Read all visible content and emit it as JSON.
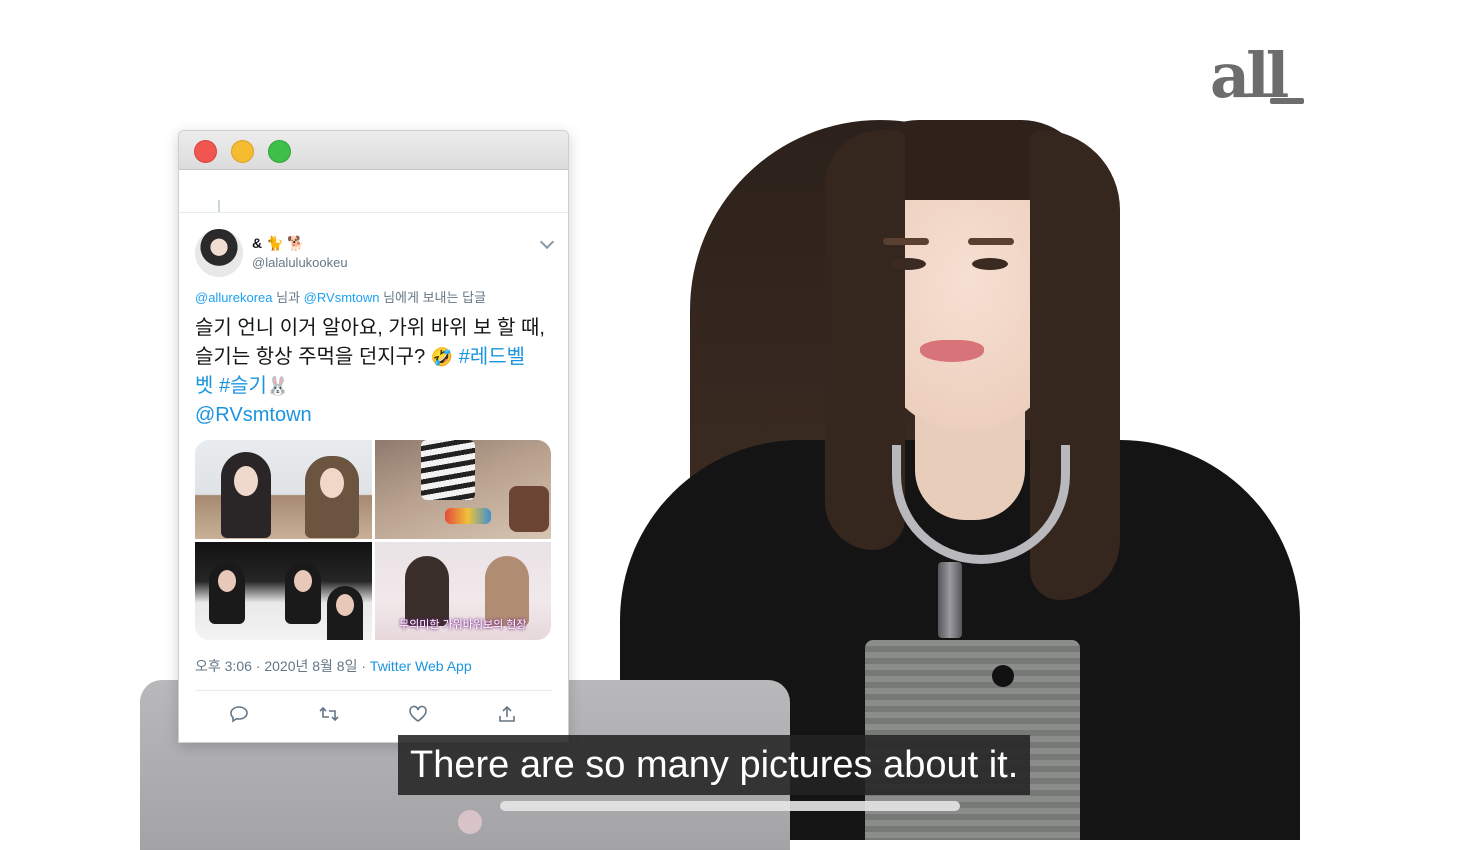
{
  "brand": {
    "logo_text": "all"
  },
  "tweet": {
    "display_name": "& 🐈 🐕",
    "handle": "@lalalulukookeu",
    "reply_to": {
      "account_1": "@allurekorea",
      "joiner": " 님과 ",
      "account_2": "@RVsmtown",
      "suffix": " 님에게 보내는 답글"
    },
    "text_line_1": "슬기 언니 이거 알아요, 가위 바위 보 할 때,",
    "text_line_2_plain": "슬기는 항상 주먹을 던지구? ",
    "emoji_1": "🤣",
    "hashtag_1_part_a": "#레드벨",
    "hashtag_1_part_b": "벳",
    "hashtag_2": "#슬기",
    "emoji_2": "🐰",
    "mention": "@RVsmtown",
    "media_caption": "무의미한 가위바위보의 현장",
    "timestamp": "오후 3:06 · 2020년 8월 8일 · ",
    "source": "Twitter Web App"
  },
  "icons": [
    "close-traffic-light",
    "minimize-traffic-light",
    "maximize-traffic-light",
    "chevron-down-icon",
    "reply-icon",
    "retweet-icon",
    "like-icon",
    "share-icon"
  ],
  "subtitle": "There are so many pictures about it.",
  "colors": {
    "twitter_blue": "#1b95e0",
    "subtitle_bg": "#232323"
  }
}
